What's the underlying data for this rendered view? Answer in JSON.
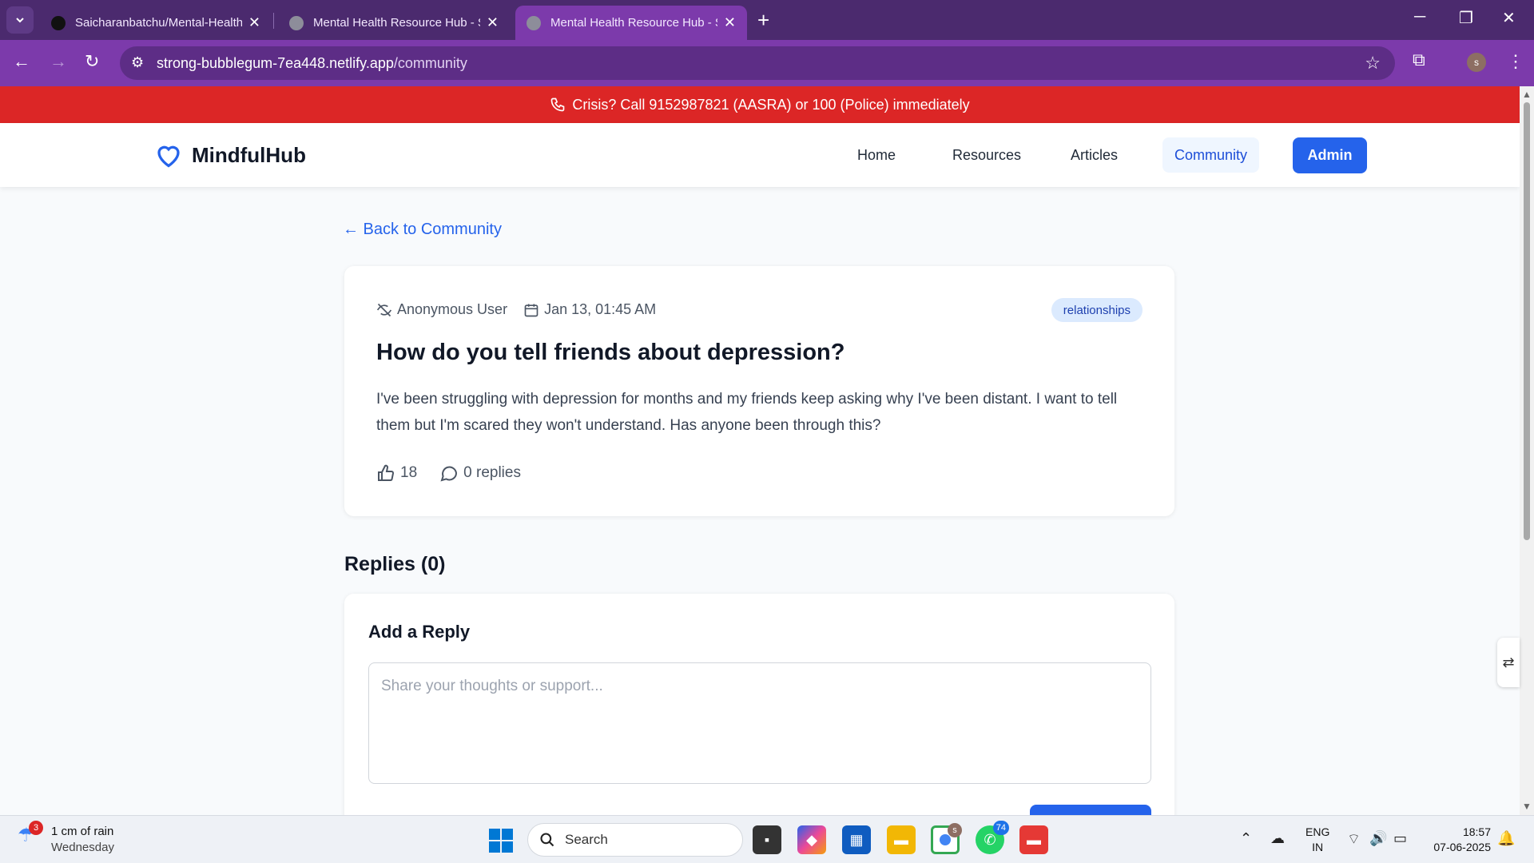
{
  "browser": {
    "tabs": [
      {
        "title": "Saicharanbatchu/Mental-Health",
        "active": false
      },
      {
        "title": "Mental Health Resource Hub - S",
        "active": false
      },
      {
        "title": "Mental Health Resource Hub - S",
        "active": true
      }
    ],
    "url_host": "strong-bubblegum-7ea448.netlify.app",
    "url_path": "/community",
    "profile_initial": "s",
    "accent_color": "#7c3aab"
  },
  "crisis_banner": {
    "text": "Crisis? Call 9152987821 (AASRA) or 100 (Police) immediately",
    "color": "#dc2626"
  },
  "site": {
    "brand": "MindfulHub",
    "nav": [
      "Home",
      "Resources",
      "Articles",
      "Community"
    ],
    "nav_active": "Community",
    "admin_label": "Admin",
    "primary_color": "#2563eb"
  },
  "page": {
    "back_link": "← Back to Community",
    "post": {
      "author": "Anonymous User",
      "date": "Jan 13, 01:45 AM",
      "tag": "relationships",
      "title": "How do you tell friends about depression?",
      "body": "I've been struggling with depression for months and my friends keep asking why I've been distant. I want to tell them but I'm scared they won't understand. Has anyone been through this?",
      "likes": "18",
      "replies": "0 replies"
    },
    "replies_heading": "Replies (0)",
    "add_reply": {
      "heading": "Add a Reply",
      "placeholder": "Share your thoughts or support..."
    }
  },
  "taskbar": {
    "weather_badge": "3",
    "weather_line1": "1 cm of rain",
    "weather_line2": "Wednesday",
    "search_label": "Search",
    "chrome_badge": "s",
    "whatsapp_badge": "74",
    "lang_line1": "ENG",
    "lang_line2": "IN",
    "time": "18:57",
    "date": "07-06-2025"
  }
}
